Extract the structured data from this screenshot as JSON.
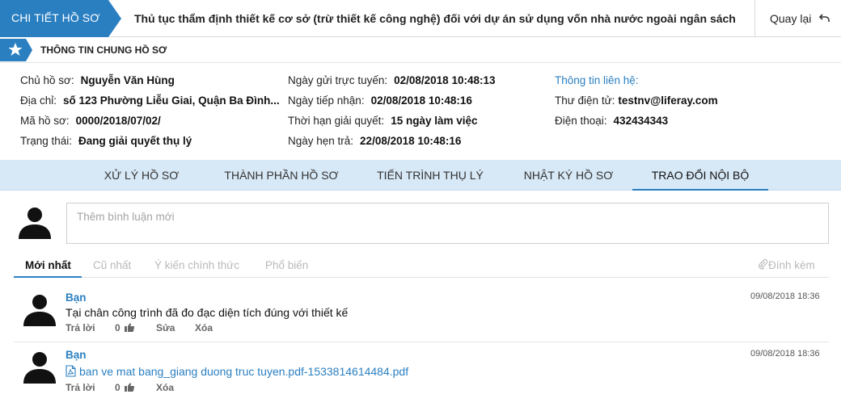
{
  "header": {
    "breadcrumb": "CHI TIẾT HỒ SƠ",
    "procedure_title": "Thủ tục thẩm định thiết kế cơ sở (trừ thiết kế công nghệ) đối với dự án sử dụng vốn nhà nước ngoài ngân sách",
    "back_label": "Quay lại"
  },
  "section": {
    "title": "THÔNG TIN CHUNG HỒ SƠ"
  },
  "info": {
    "owner_label": "Chủ hồ sơ:",
    "owner_value": "Nguyễn Văn Hùng",
    "address_label": "Địa chỉ:",
    "address_value": "số 123 Phường Liễu Giai, Quận Ba Đình...",
    "code_label": "Mã hồ sơ:",
    "code_value": "0000/2018/07/02/",
    "status_label": "Trạng thái:",
    "status_value": "Đang giải quyết thụ lý",
    "submitted_label": "Ngày gửi trực tuyến:",
    "submitted_value": "02/08/2018 10:48:13",
    "received_label": "Ngày tiếp nhận:",
    "received_value": "02/08/2018 10:48:16",
    "deadline_label": "Thời hạn giải quyết:",
    "deadline_value": "15 ngày làm việc",
    "due_label": "Ngày hẹn trả:",
    "due_value": "22/08/2018 10:48:16",
    "contact_title": "Thông tin liên hệ:",
    "email_label": "Thư điện tử:",
    "email_value": "testnv@liferay.com",
    "phone_label": "Điện thoại:",
    "phone_value": "432434343"
  },
  "tabs": [
    {
      "label": "XỬ LÝ HỒ SƠ"
    },
    {
      "label": "THÀNH PHẦN HỒ SƠ"
    },
    {
      "label": "TIẾN TRÌNH THỤ LÝ"
    },
    {
      "label": "NHẬT KÝ HỒ SƠ"
    },
    {
      "label": "TRAO ĐỔI NỘI BỘ"
    }
  ],
  "active_tab": "TRAO ĐỔI NỘI BỘ",
  "composer": {
    "placeholder": "Thêm bình luận mới"
  },
  "filters": [
    {
      "label": "Mới nhất"
    },
    {
      "label": "Cũ nhất"
    },
    {
      "label": "Ý kiến chính thức"
    },
    {
      "label": "Phổ biến"
    }
  ],
  "attach_label": "Đính kèm",
  "comments": [
    {
      "author": "Bạn",
      "text": "Tại chân công trình đã đo đạc diện tích đúng với thiết kế",
      "time": "09/08/2018 18:36",
      "reply": "Trả lời",
      "likes": "0",
      "edit": "Sửa",
      "delete": "Xóa"
    },
    {
      "author": "Bạn",
      "file": "ban ve mat bang_giang duong truc tuyen.pdf-1533814614484.pdf",
      "time": "09/08/2018 18:36",
      "reply": "Trả lời",
      "likes": "0",
      "delete": "Xóa"
    }
  ],
  "colors": {
    "accent": "#2a7fc1",
    "breadcrumb_bg": "#2a7fc1",
    "tabs_bg": "#d7e8f6"
  },
  "icons": [
    "star-icon",
    "back-arrow-icon",
    "user-avatar-icon",
    "paperclip-icon",
    "thumbs-up-icon",
    "pdf-file-icon"
  ]
}
